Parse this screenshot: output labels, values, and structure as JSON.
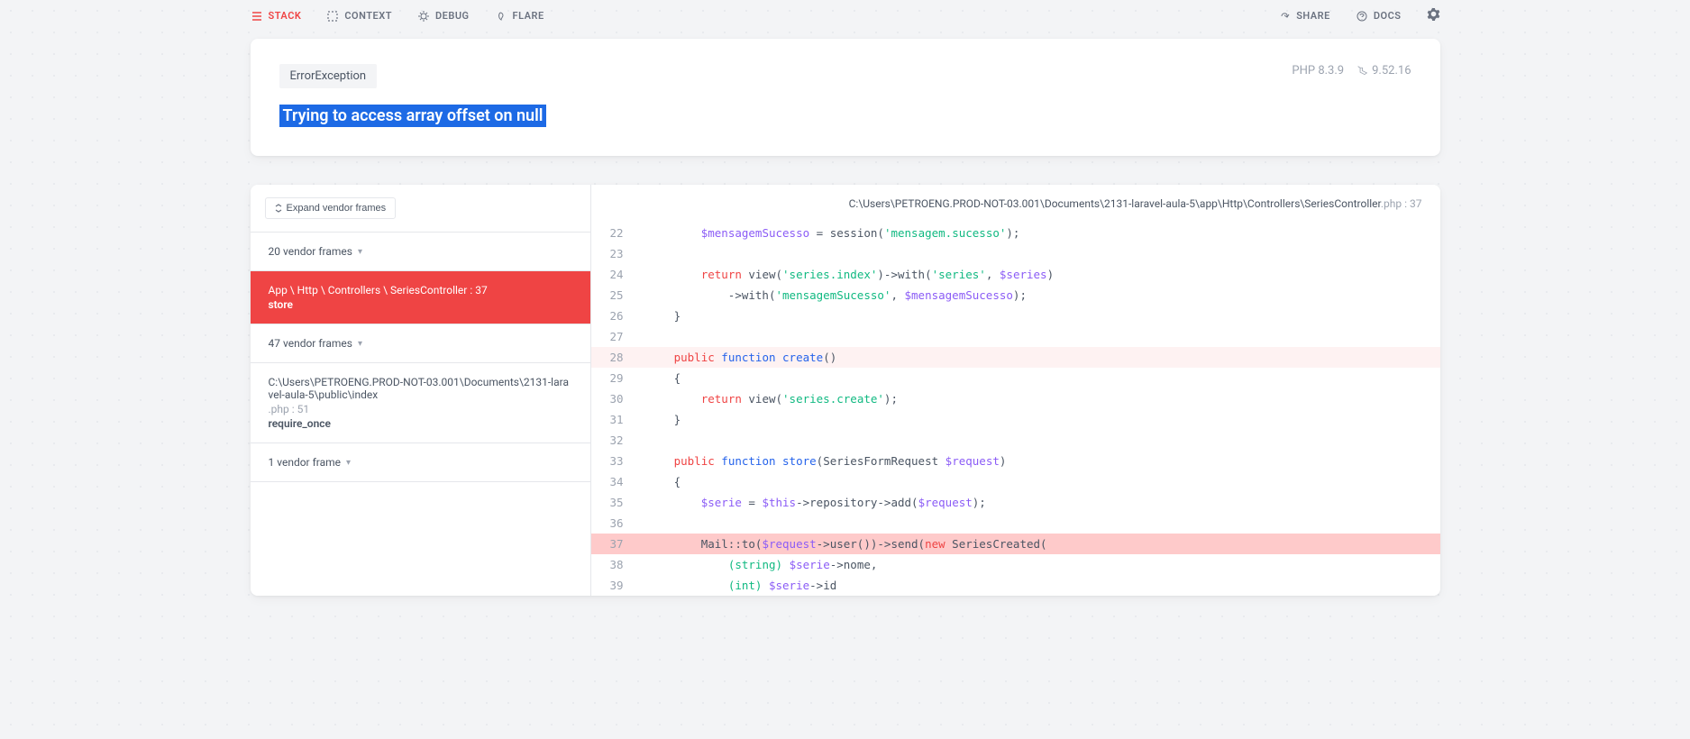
{
  "nav": {
    "stack": "STACK",
    "context": "CONTEXT",
    "debug": "DEBUG",
    "flare": "FLARE",
    "share": "SHARE",
    "docs": "DOCS"
  },
  "header": {
    "exception_class": "ErrorException",
    "php_version": "PHP 8.3.9",
    "laravel_version": "9.52.16",
    "message": "Trying to access array offset on null"
  },
  "stack": {
    "expand_label": "Expand vendor frames",
    "group1": "20 vendor frames",
    "active_path": "App \\ Http \\ Controllers \\ SeriesController : 37",
    "active_fn": "store",
    "group2": "47 vendor frames",
    "frame_detail_path": "C:\\Users\\PETROENG.PROD-NOT-03.001\\Documents\\2131-laravel-aula-5\\public\\index",
    "frame_detail_meta": ".php : 51",
    "frame_detail_fn": "require_once",
    "group3": "1 vendor frame"
  },
  "code": {
    "file_path": "C:\\Users\\PETROENG.PROD-NOT-03.001\\Documents\\2131-laravel-aula-5\\app\\Http\\Controllers\\SeriesController",
    "file_ext": ".php : 37",
    "lines": {
      "22": {
        "n": "22"
      },
      "23": {
        "n": "23"
      },
      "24": {
        "n": "24"
      },
      "25": {
        "n": "25"
      },
      "26": {
        "n": "26"
      },
      "27": {
        "n": "27"
      },
      "28": {
        "n": "28"
      },
      "29": {
        "n": "29"
      },
      "30": {
        "n": "30"
      },
      "31": {
        "n": "31"
      },
      "32": {
        "n": "32"
      },
      "33": {
        "n": "33"
      },
      "34": {
        "n": "34"
      },
      "35": {
        "n": "35"
      },
      "36": {
        "n": "36"
      },
      "37": {
        "n": "37"
      },
      "38": {
        "n": "38"
      },
      "39": {
        "n": "39"
      }
    },
    "tokens": {
      "l22_var": "$mensagemSucesso",
      "l22_eq": " = session(",
      "l22_str": "'mensagem.sucesso'",
      "l22_end": ");",
      "l24_kw": "return",
      "l24_fn": " view(",
      "l24_str": "'series.index'",
      "l24_mid": ")->with(",
      "l24_str2": "'series'",
      "l24_c": ", ",
      "l24_var": "$series",
      "l24_end": ")",
      "l25_pre": "            ->with(",
      "l25_str": "'mensagemSucesso'",
      "l25_c": ", ",
      "l25_var": "$mensagemSucesso",
      "l25_end": ");",
      "l26": "    }",
      "l28_pub": "public",
      "l28_fun": " function ",
      "l28_name": "create",
      "l28_paren": "()",
      "l29": "    {",
      "l30_kw": "return",
      "l30_fn": " view(",
      "l30_str": "'series.create'",
      "l30_end": ");",
      "l31": "    }",
      "l33_pub": "public",
      "l33_fun": " function ",
      "l33_name": "store",
      "l33_sig1": "(SeriesFormRequest ",
      "l33_var": "$request",
      "l33_sig2": ")",
      "l34": "    {",
      "l35_var1": "$serie",
      "l35_eq": " = ",
      "l35_var2": "$this",
      "l35_mid": "->repository->add(",
      "l35_var3": "$request",
      "l35_end": ");",
      "l37_pre": "        Mail::to(",
      "l37_var": "$request",
      "l37_mid": "->user())->send(",
      "l37_new": "new",
      "l37_cls": " SeriesCreated(",
      "l38_cast": "(string)",
      "l38_sp": " ",
      "l38_var": "$serie",
      "l38_end": "->nome,",
      "l39_cast": "(int)",
      "l39_sp": " ",
      "l39_var": "$serie",
      "l39_end": "->id"
    }
  }
}
